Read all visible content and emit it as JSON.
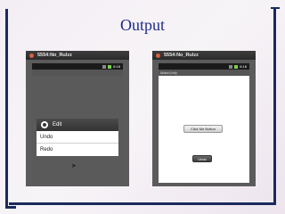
{
  "slide": {
    "title": "Output"
  },
  "left_emulator": {
    "window_title": "5554:No_Rulzz",
    "status_time": "6:18",
    "menu": {
      "header": "Edit",
      "items": [
        "Undo",
        "Redo"
      ]
    }
  },
  "right_emulator": {
    "window_title": "5554:No_Rulzz",
    "status_time": "6:18",
    "app_title": "MakeUnify",
    "click_button_label": "Click Me Button",
    "undo_button_label": "Undo"
  },
  "colors": {
    "frame": "#1b2a5c",
    "title": "#1e2a8c",
    "emulator_bg": "#5b5b5b"
  }
}
